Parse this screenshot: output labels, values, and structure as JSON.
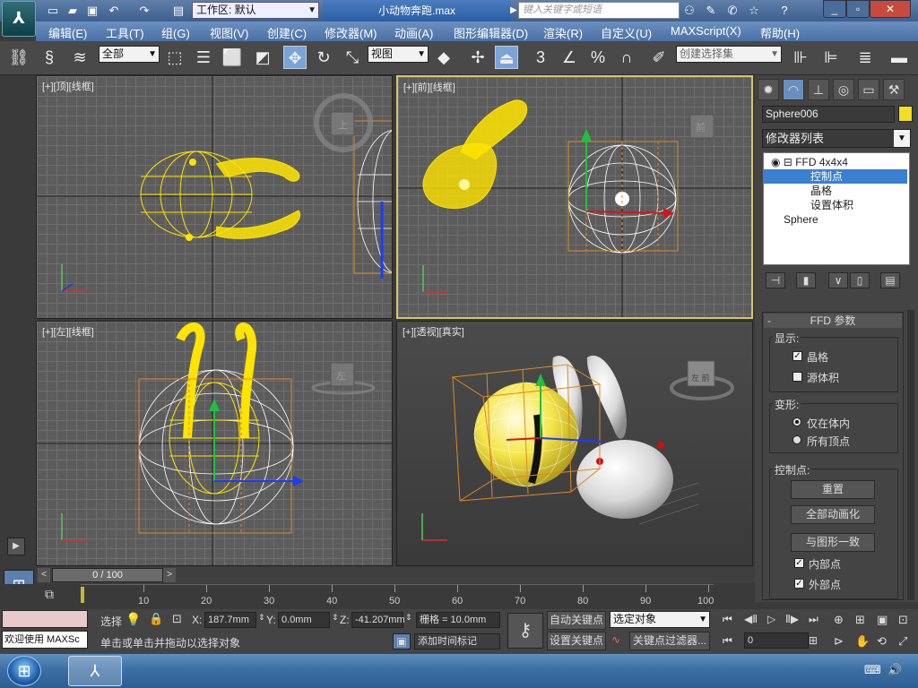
{
  "title_bar": {
    "workspace_label": "工作区: 默认",
    "filename": "小动物奔跑.max",
    "search_placeholder": "键入关键字或短语"
  },
  "menu": [
    "编辑(E)",
    "工具(T)",
    "组(G)",
    "视图(V)",
    "创建(C)",
    "修改器(M)",
    "动画(A)",
    "图形编辑器(D)",
    "渲染(R)",
    "自定义(U)",
    "MAXScript(X)",
    "帮助(H)"
  ],
  "toolbar": {
    "selection_filter": "全部",
    "ref_coord": "视图",
    "named_selection_placeholder": "创建选择集",
    "snap_label": "3",
    "percent_snap": "%"
  },
  "viewports": {
    "top": {
      "label": "[+][顶][线框]",
      "cube": "上"
    },
    "front": {
      "label": "[+][前][线框]",
      "cube": "前"
    },
    "left": {
      "label": "[+][左][线框]",
      "cube": "左"
    },
    "perspective": {
      "label": "[+][透视][真实]",
      "cube": "左 前"
    }
  },
  "command_panel": {
    "object_name": "Sphere006",
    "object_color": "#f0e020",
    "modifier_list": "修改器列表",
    "stack": {
      "ffd": "FFD 4x4x4",
      "control_points": "控制点",
      "lattice": "晶格",
      "set_volume": "设置体积",
      "sphere": "Sphere"
    },
    "ffd_params": {
      "title": "FFD 参数",
      "display_group": "显示:",
      "lattice_cb": "晶格",
      "source_volume_cb": "源体积",
      "deform_group": "变形:",
      "only_in_volume": "仅在体内",
      "all_vertices": "所有顶点",
      "control_points_group": "控制点:",
      "reset_btn": "重置",
      "animate_all_btn": "全部动画化",
      "conform_btn": "与图形一致",
      "inside_points": "内部点",
      "outside_points": "外部点"
    }
  },
  "timeline": {
    "frame_readout": "0 / 100",
    "ticks": [
      "10",
      "20",
      "30",
      "40",
      "50",
      "60",
      "70",
      "80",
      "90",
      "100"
    ]
  },
  "status": {
    "welcome": "欢迎使用 MAXSc",
    "select_label": "选择",
    "x_label": "X:",
    "x_value": "187.7mm",
    "y_label": "Y:",
    "y_value": "0.0mm",
    "z_label": "Z:",
    "z_value": "-41.207mm",
    "grid_value": "栅格 = 10.0mm",
    "prompt": "单击或单击并拖动以选择对象",
    "add_time_tag": "添加时间标记",
    "auto_key": "自动关键点",
    "set_key": "设置关键点",
    "key_mode": "选定对象",
    "key_filters": "关键点过滤器...",
    "current_frame": "0"
  }
}
